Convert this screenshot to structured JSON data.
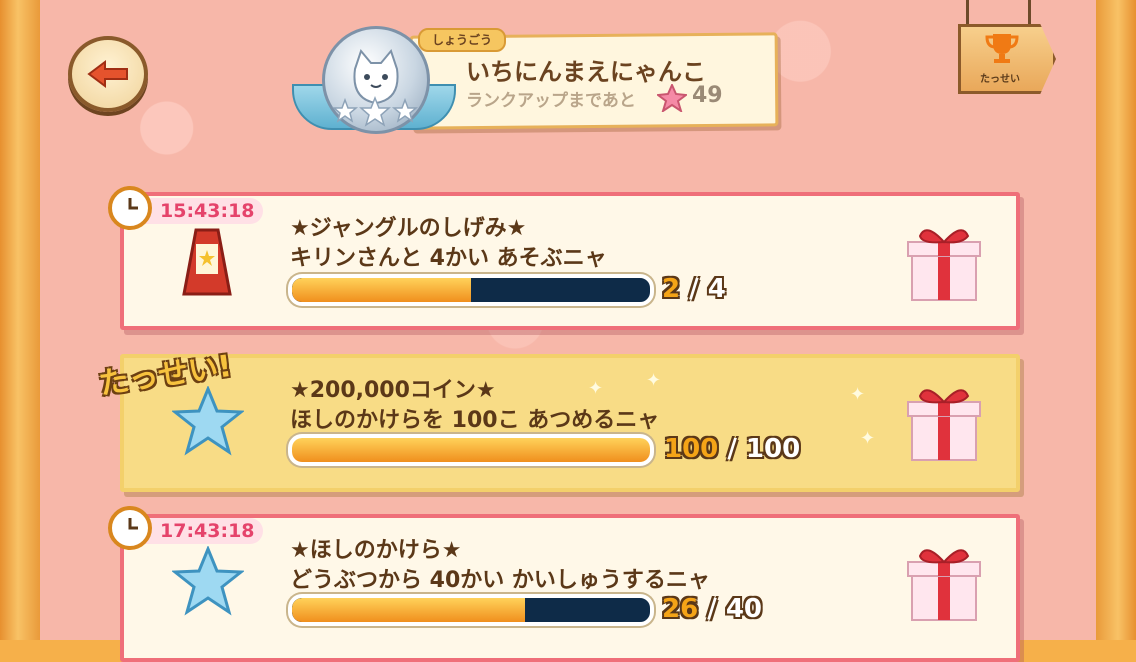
{
  "header": {
    "title_tag": "しょうごう",
    "rank_name": "いちにんまえにゃんこ",
    "rank_up_label": "ランクアップまであと",
    "rank_up_remaining": "49",
    "achievement_sign_label": "たっせい"
  },
  "missions": [
    {
      "timer": "15:43:18",
      "title": "★ジャングルのしげみ★",
      "description": "キリンさんと 4かい あそぶニャ",
      "current": "2",
      "separator": "/",
      "total": "4",
      "progress": 0.5,
      "icon": "signboard-icon",
      "status": "in-progress"
    },
    {
      "timer": "",
      "title": "★200,000コイン★",
      "description": "ほしのかけらを 100こ あつめるニャ",
      "current": "100",
      "separator": "/",
      "total": "100",
      "progress": 1.0,
      "icon": "star-icon",
      "status": "complete",
      "complete_label": "たっせい!"
    },
    {
      "timer": "17:43:18",
      "title": "★ほしのかけら★",
      "description": "どうぶつから 40かい かいしゅうするニャ",
      "current": "26",
      "separator": "/",
      "total": "40",
      "progress": 0.65,
      "icon": "star-icon",
      "status": "in-progress"
    }
  ],
  "colors": {
    "background": "#f7b7a9",
    "card_border": "#ef6f79",
    "complete_card": "#f8dc86",
    "timer_text": "#e5436b",
    "progress_fill": "#f5a417"
  }
}
